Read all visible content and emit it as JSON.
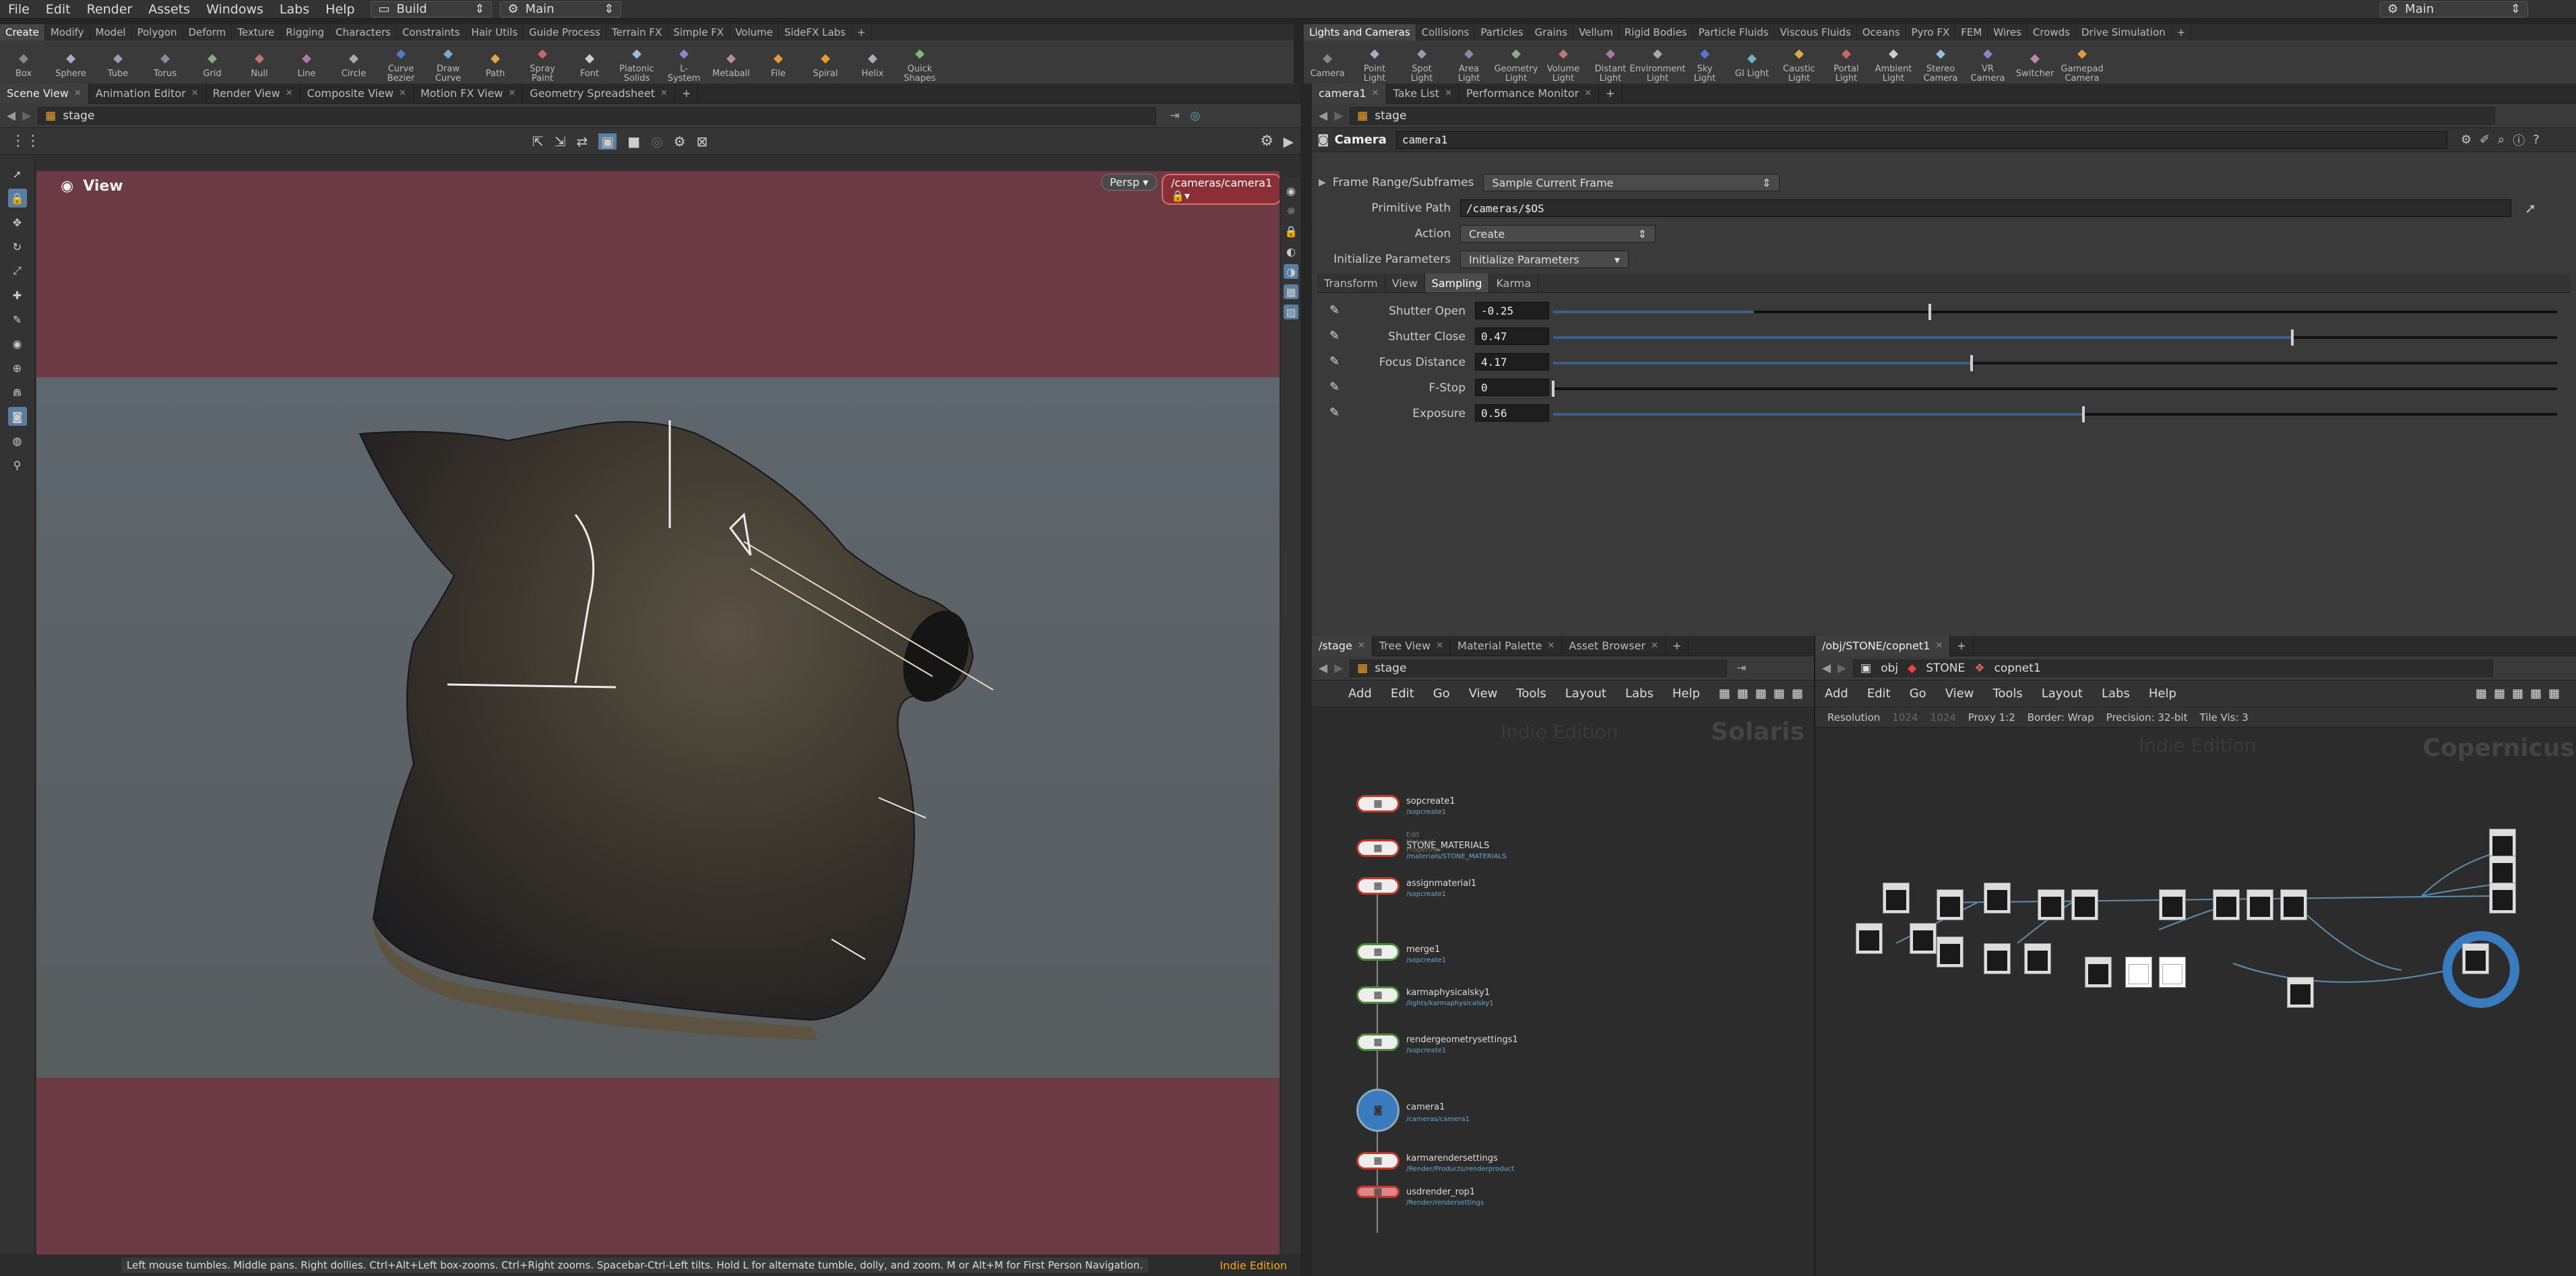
{
  "menubar": {
    "items": [
      "File",
      "Edit",
      "Render",
      "Assets",
      "Windows",
      "Labs",
      "Help"
    ],
    "desktop": "Build",
    "main_left": "Main",
    "main_right": "Main"
  },
  "shelf_left": {
    "tabs": [
      "Create",
      "Modify",
      "Model",
      "Polygon",
      "Deform",
      "Texture",
      "Rigging",
      "Characters",
      "Constraints",
      "Hair Utils",
      "Guide Process",
      "Terrain FX",
      "Simple FX",
      "Volume",
      "SideFX Labs"
    ],
    "tools": [
      "Box",
      "Sphere",
      "Tube",
      "Torus",
      "Grid",
      "Null",
      "Line",
      "Circle",
      "Curve Bezier",
      "Draw Curve",
      "Path",
      "Spray Paint",
      "Font",
      "Platonic Solids",
      "L-System",
      "Metaball",
      "File",
      "Spiral",
      "Helix",
      "Quick Shapes"
    ]
  },
  "shelf_right": {
    "tabs": [
      "Lights and Cameras",
      "Collisions",
      "Particles",
      "Grains",
      "Vellum",
      "Rigid Bodies",
      "Particle Fluids",
      "Viscous Fluids",
      "Oceans",
      "Pyro FX",
      "FEM",
      "Wires",
      "Crowds",
      "Drive Simulation"
    ],
    "tools": [
      "Camera",
      "Point Light",
      "Spot Light",
      "Area Light",
      "Geometry Light",
      "Volume Light",
      "Distant Light",
      "Environment Light",
      "Sky Light",
      "GI Light",
      "Caustic Light",
      "Portal Light",
      "Ambient Light",
      "Stereo Camera",
      "VR Camera",
      "Switcher",
      "Gamepad Camera"
    ]
  },
  "viewer": {
    "tabs": [
      "Scene View",
      "Animation Editor",
      "Render View",
      "Composite View",
      "Motion FX View",
      "Geometry Spreadsheet"
    ],
    "path": "stage",
    "title": "View",
    "persp": "Persp",
    "camera": "/cameras/camera1",
    "status": "Left mouse tumbles. Middle pans. Right dollies. Ctrl+Alt+Left box-zooms. Ctrl+Right zooms. Spacebar-Ctrl-Left tilts. Hold L for alternate tumble, dolly, and zoom. M or Alt+M for First Person Navigation.",
    "edition": "Indie Edition"
  },
  "params": {
    "tabs": [
      "camera1",
      "Take List",
      "Performance Monitor"
    ],
    "path": "stage",
    "node_type": "Camera",
    "node_name": "camera1",
    "frame_range_label": "Frame Range/Subframes",
    "frame_range_value": "Sample Current Frame",
    "prim_path_label": "Primitive Path",
    "prim_path_value": "/cameras/$OS",
    "action_label": "Action",
    "action_value": "Create",
    "init_label": "Initialize Parameters",
    "init_value": "Initialize Parameters",
    "subtabs": [
      "Transform",
      "View",
      "Sampling",
      "Karma"
    ],
    "rows": [
      {
        "label": "Shutter Open",
        "value": "-0.25",
        "fill": 0.2,
        "knob": 0.375
      },
      {
        "label": "Shutter Close",
        "value": "0.47",
        "fill": 0.736,
        "knob": 0.736
      },
      {
        "label": "Focus Distance",
        "value": "4.17",
        "fill": 0.417,
        "knob": 0.417
      },
      {
        "label": "F-Stop",
        "value": "0",
        "fill": 0,
        "knob": 0
      },
      {
        "label": "Exposure",
        "value": "0.56",
        "fill": 0.528,
        "knob": 0.528
      }
    ]
  },
  "solaris": {
    "tabs": [
      "/stage",
      "Tree View",
      "Material Palette",
      "Asset Browser"
    ],
    "path": "stage",
    "menu": [
      "Add",
      "Edit",
      "Go",
      "View",
      "Tools",
      "Layout",
      "Labs",
      "Help"
    ],
    "watermark_edition": "Indie Edition",
    "watermark": "Solaris",
    "nodes": [
      {
        "name": "sopcreate1",
        "sub": "/sopcreate1",
        "color": "red"
      },
      {
        "name": "STONE_MATERIALS",
        "sub": "/materials/STONE_MATERIALS",
        "note": "Edit Material Properties",
        "color": "red"
      },
      {
        "name": "assignmaterial1",
        "sub": "/sopcreate1",
        "color": "red"
      },
      {
        "name": "merge1",
        "sub": "/sopcreate1",
        "color": "green"
      },
      {
        "name": "karmaphysicalsky1",
        "sub": "/lights/karmaphysicalsky1",
        "color": "green"
      },
      {
        "name": "rendergeometrysettings1",
        "sub": "/sopcreate1",
        "color": "green"
      },
      {
        "name": "camera1",
        "sub": "/cameras/camera1",
        "color": "blue"
      },
      {
        "name": "karmarendersettings",
        "sub": "/Render/Products/renderproduct",
        "color": "red"
      },
      {
        "name": "usdrender_rop1",
        "sub": "/Render/rendersettings",
        "color": "pink"
      }
    ]
  },
  "copernicus": {
    "tabs": [
      "/obj/STONE/copnet1"
    ],
    "crumbs": [
      "obj",
      "STONE",
      "copnet1"
    ],
    "menu": [
      "Add",
      "Edit",
      "Go",
      "View",
      "Tools",
      "Layout",
      "Labs",
      "Help"
    ],
    "resolution_label": "Resolution",
    "res_x": "1024",
    "res_y": "1024",
    "proxy": "Proxy 1:2",
    "border": "Border: Wrap",
    "precision": "Precision: 32-bit",
    "tile": "Tile Vis: 3",
    "watermark_edition": "Indie Edition",
    "watermark": "Copernicus"
  },
  "colors": {
    "accent": "#f5a623",
    "node_red": "#c0392b",
    "node_green": "#4a8a3a",
    "node_blue": "#3a7abf",
    "viewport_top": "#6b3a42",
    "viewport_mid": "#566066",
    "viewport_bottom": "#6b3a42"
  }
}
